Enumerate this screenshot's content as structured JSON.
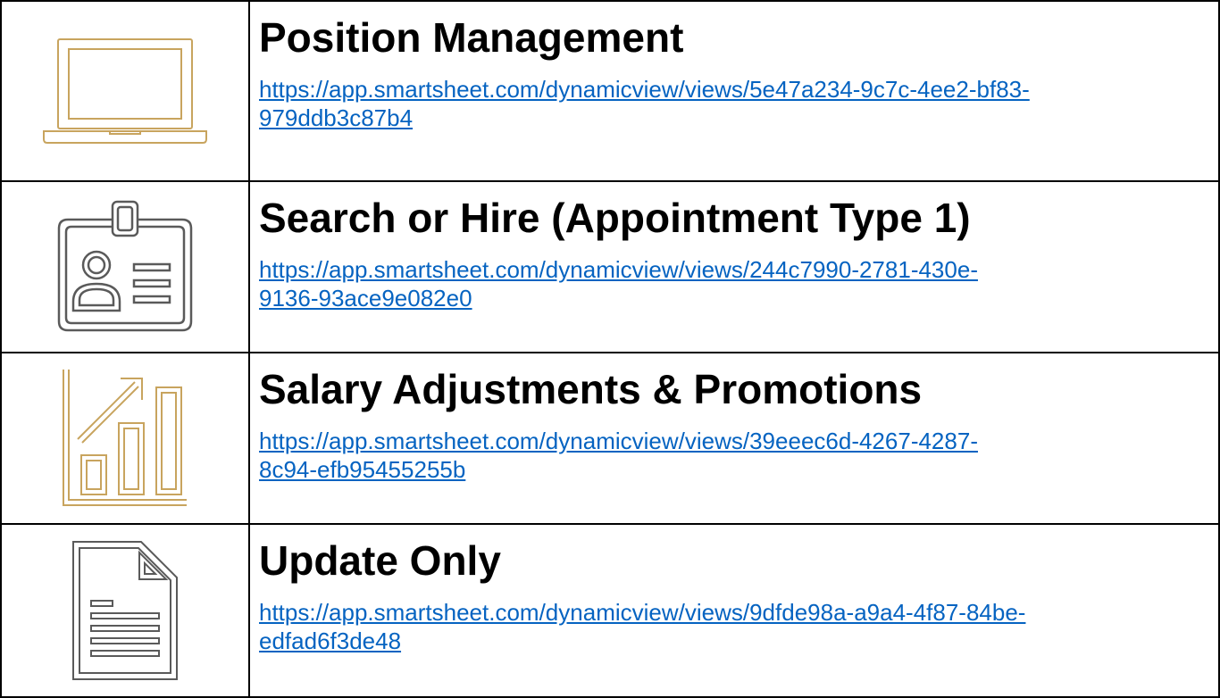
{
  "colors": {
    "gold": "#c8a45e",
    "gray": "#5a5a5a",
    "link": "#0563c1",
    "border": "#000000"
  },
  "rows": [
    {
      "icon": "laptop-icon",
      "title": "Position Management",
      "url_line1": "https://app.smartsheet.com/dynamicview/views/5e47a234-9c7c-4ee2-bf83-",
      "url_line2": "979ddb3c87b4"
    },
    {
      "icon": "id-badge-icon",
      "title": "Search or Hire (Appointment Type 1)",
      "url_line1": "https://app.smartsheet.com/dynamicview/views/244c7990-2781-430e-",
      "url_line2": "9136-93ace9e082e0"
    },
    {
      "icon": "growth-chart-icon",
      "title": "Salary Adjustments & Promotions",
      "url_line1": "https://app.smartsheet.com/dynamicview/views/39eeec6d-4267-4287-",
      "url_line2": "8c94-efb95455255b"
    },
    {
      "icon": "document-icon",
      "title": "Update Only",
      "url_line1": "https://app.smartsheet.com/dynamicview/views/9dfde98a-a9a4-4f87-84be-",
      "url_line2": "edfad6f3de48"
    }
  ]
}
